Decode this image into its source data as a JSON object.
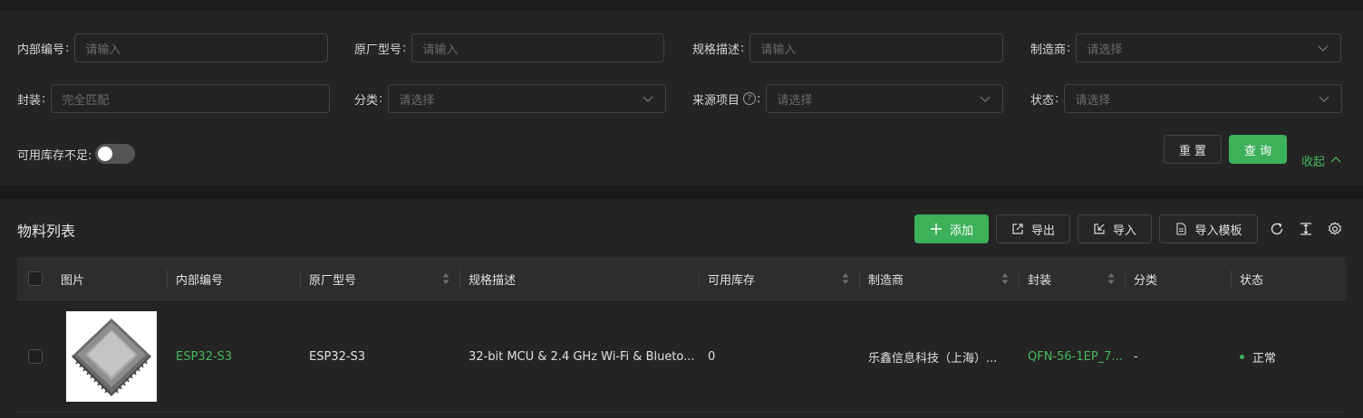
{
  "filters": {
    "internal_no": {
      "label": "内部编号",
      "placeholder": "请输入"
    },
    "mfr_model": {
      "label": "原厂型号",
      "placeholder": "请输入"
    },
    "spec": {
      "label": "规格描述",
      "placeholder": "请输入"
    },
    "manufacturer": {
      "label": "制造商",
      "placeholder": "请选择"
    },
    "package": {
      "label": "封装",
      "placeholder": "完全匹配"
    },
    "category": {
      "label": "分类",
      "placeholder": "请选择"
    },
    "source_project": {
      "label": "来源项目",
      "placeholder": "请选择",
      "help_icon": "?"
    },
    "status": {
      "label": "状态",
      "placeholder": "请选择"
    },
    "low_stock": {
      "label": "可用库存不足:",
      "enabled": false
    },
    "reset_label": "重 置",
    "query_label": "查 询",
    "collapse_label": "收起"
  },
  "list": {
    "title": "物料列表",
    "add_label": "添加",
    "export_label": "导出",
    "import_label": "导入",
    "import_template_label": "导入模板",
    "columns": [
      "图片",
      "内部编号",
      "原厂型号",
      "规格描述",
      "可用库存",
      "制造商",
      "封装",
      "分类",
      "状态"
    ],
    "rows": [
      {
        "internal_no": "ESP32-S3",
        "mfr_model": "ESP32-S3",
        "spec": "32-bit MCU & 2.4 GHz Wi-Fi & Blueto...",
        "stock": "0",
        "manufacturer": "乐鑫信息科技（上海）...",
        "package": "QFN-56-1EP_7...",
        "category": "-",
        "status": "正常"
      }
    ]
  },
  "colors": {
    "accent": "#3db15a",
    "link": "#45b85e",
    "background": "#242424"
  },
  "icons": [
    "chevron-down-icon",
    "help-circle-icon",
    "chevron-up-icon",
    "plus-icon",
    "export-icon",
    "import-icon",
    "file-template-icon",
    "refresh-icon",
    "column-height-icon",
    "settings-gear-icon",
    "sort-icon"
  ]
}
